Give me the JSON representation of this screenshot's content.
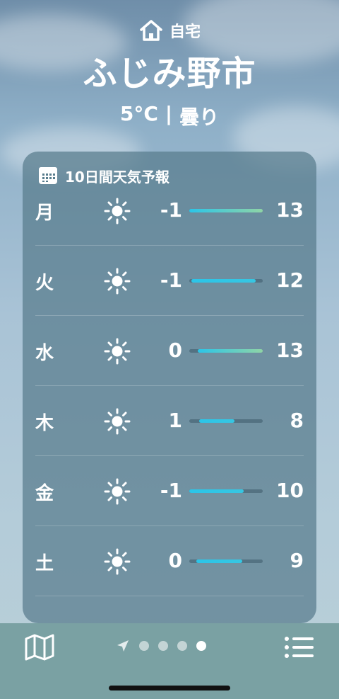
{
  "location": {
    "label": "自宅",
    "icon": "house-icon"
  },
  "city": "ふじみ野市",
  "current": {
    "temp": "5°C",
    "separator": "|",
    "condition": "曇り"
  },
  "forecast": {
    "title": "10日間天気予報",
    "icon": "calendar-icon",
    "days": [
      {
        "day": "月",
        "icon": "sun-icon",
        "low": "-1",
        "high": "13",
        "range": [
          0.0,
          1.0
        ]
      },
      {
        "day": "火",
        "icon": "sun-icon",
        "low": "-1",
        "high": "12",
        "range": [
          0.03,
          0.9
        ]
      },
      {
        "day": "水",
        "icon": "sun-icon",
        "low": "0",
        "high": "13",
        "range": [
          0.12,
          1.0
        ]
      },
      {
        "day": "木",
        "icon": "sun-icon",
        "low": "1",
        "high": "8",
        "range": [
          0.13,
          0.62
        ]
      },
      {
        "day": "金",
        "icon": "sun-icon",
        "low": "-1",
        "high": "10",
        "range": [
          0.0,
          0.74
        ]
      },
      {
        "day": "土",
        "icon": "sun-icon",
        "low": "0",
        "high": "9",
        "range": [
          0.1,
          0.72
        ]
      }
    ]
  },
  "toolbar": {
    "map_icon": "map-icon",
    "list_icon": "list-icon",
    "location_icon": "location-arrow-icon",
    "pages": 4,
    "active_page": 3
  }
}
